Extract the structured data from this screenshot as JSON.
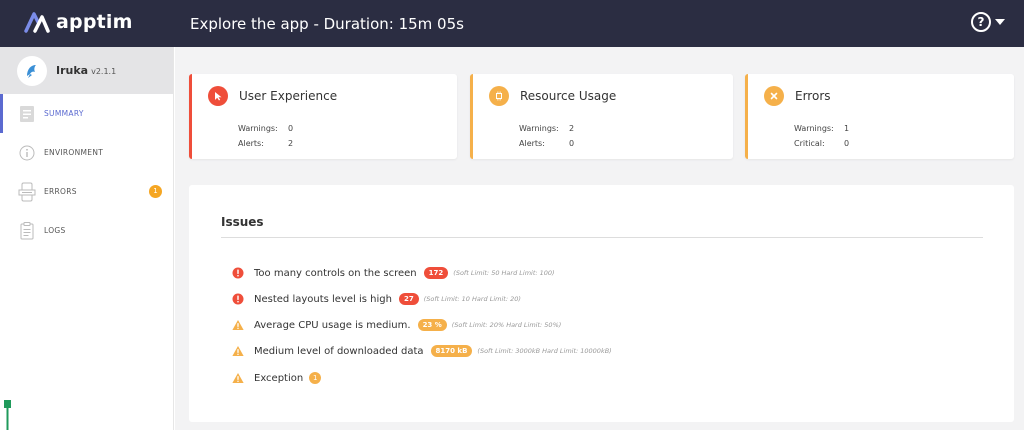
{
  "header": {
    "brand": "apptim",
    "title": "Explore the app - Duration: 15m 05s",
    "help_symbol": "?"
  },
  "sidebar": {
    "app_name": "Iruka",
    "app_version": "v2.1.1",
    "items": [
      {
        "label": "SUMMARY",
        "icon": "summary-icon",
        "active": true
      },
      {
        "label": "ENVIRONMENT",
        "icon": "info-icon"
      },
      {
        "label": "ERRORS",
        "icon": "errors-icon",
        "badge": "1"
      },
      {
        "label": "LOGS",
        "icon": "logs-icon"
      }
    ]
  },
  "cards": [
    {
      "title": "User Experience",
      "icon": "cursor-icon",
      "color": "#ef4e3a",
      "stats": [
        {
          "label": "Warnings:",
          "value": "0"
        },
        {
          "label": "Alerts:",
          "value": "2"
        }
      ]
    },
    {
      "title": "Resource Usage",
      "icon": "cpu-icon",
      "color": "#f5b04a",
      "stats": [
        {
          "label": "Warnings:",
          "value": "2"
        },
        {
          "label": "Alerts:",
          "value": "0"
        }
      ]
    },
    {
      "title": "Errors",
      "icon": "x-icon",
      "color": "#f5b04a",
      "stats": [
        {
          "label": "Warnings:",
          "value": "1"
        },
        {
          "label": "Critical:",
          "value": "0"
        }
      ]
    }
  ],
  "issues": {
    "title": "Issues",
    "items": [
      {
        "text": "Too many controls on the screen",
        "level": "error",
        "value": "172",
        "limits": "(Soft Limit: 50 Hard Limit: 100)"
      },
      {
        "text": "Nested layouts level is high",
        "level": "error",
        "value": "27",
        "limits": "(Soft Limit: 10 Hard Limit: 20)"
      },
      {
        "text": "Average CPU usage is medium.",
        "level": "warning",
        "value": "23 %",
        "limits": "(Soft Limit: 20% Hard Limit: 50%)"
      },
      {
        "text": "Medium level of downloaded data",
        "level": "warning",
        "value": "8170 kB",
        "limits": "(Soft Limit: 3000kB Hard Limit: 10000kB)"
      },
      {
        "text": "Exception",
        "level": "warning",
        "badge": "1"
      }
    ]
  },
  "colors": {
    "topbar": "#2b2d42",
    "accent": "#5b6ad0",
    "error": "#ef4e3a",
    "warning": "#f5b04a"
  }
}
